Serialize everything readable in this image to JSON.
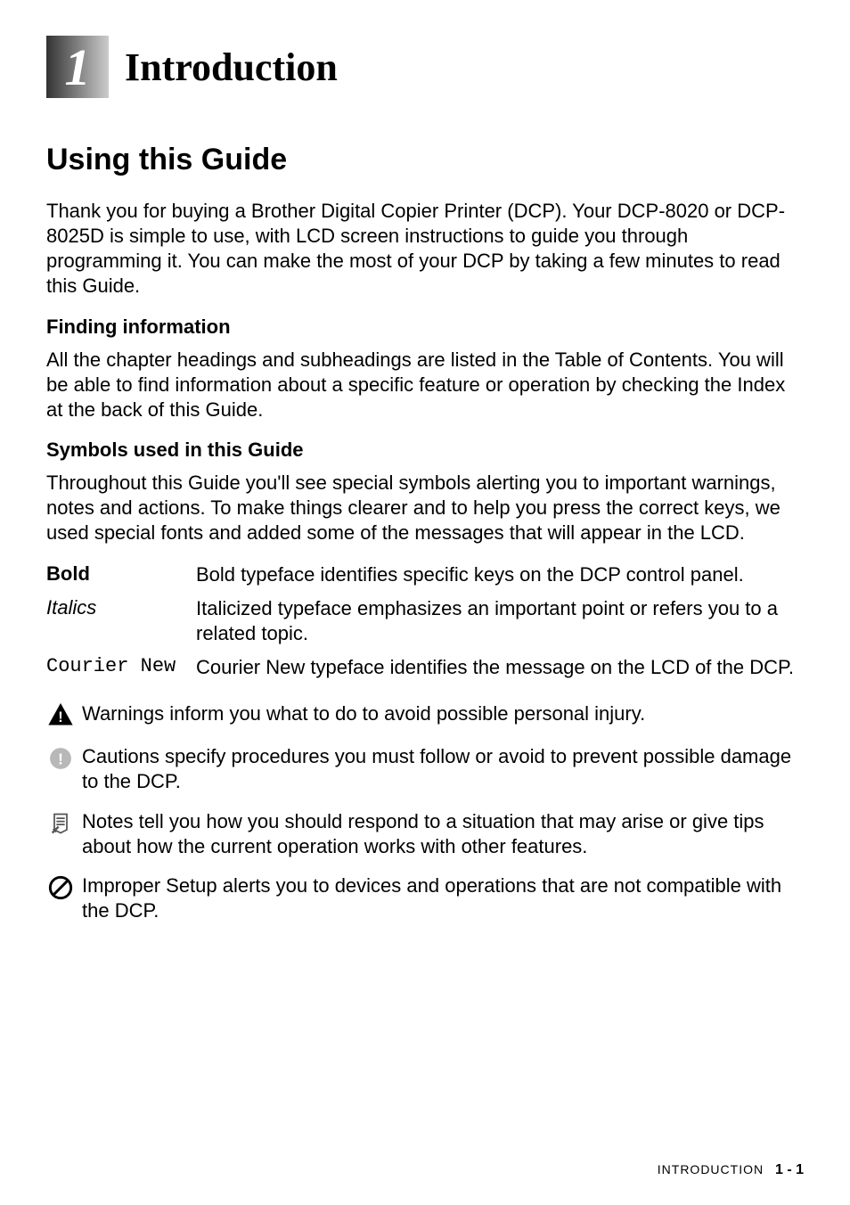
{
  "chapter": {
    "number": "1",
    "title": "Introduction"
  },
  "section": {
    "title": "Using this Guide",
    "intro": "Thank you for buying a Brother Digital Copier Printer (DCP). Your DCP-8020 or DCP-8025D is simple to use, with LCD screen instructions to guide you through programming it. You can make the most of your DCP by taking a few minutes to read this Guide."
  },
  "subsections": {
    "finding": {
      "title": "Finding information",
      "text": "All the chapter headings and subheadings are listed in the Table of Contents. You will be able to find information about a specific feature or operation by checking the Index at the back of this Guide."
    },
    "symbols": {
      "title": "Symbols used in this Guide",
      "text": "Throughout this Guide you'll see special symbols alerting you to important warnings, notes and actions. To make things clearer and to help you press the correct keys, we used special fonts and added some of the messages that will appear in the LCD."
    }
  },
  "typefaces": {
    "bold": {
      "label": "Bold",
      "desc": "Bold typeface identifies specific keys on the DCP control panel."
    },
    "italics": {
      "label": "Italics",
      "desc": "Italicized typeface emphasizes an important point or refers you to a related topic."
    },
    "courier": {
      "label": "Courier New",
      "desc": "Courier New typeface identifies the message on the LCD of the DCP."
    }
  },
  "symbolblocks": {
    "warning": "Warnings inform you what to do to avoid possible personal injury.",
    "caution": "Cautions specify procedures you must follow or avoid to prevent possible damage to the DCP.",
    "note": "Notes tell you how you should respond to a situation that may arise or give tips about how the current operation works with other features.",
    "improper": "Improper Setup alerts you to devices and operations that are not compatible with the DCP."
  },
  "footer": {
    "label": "INTRODUCTION",
    "page": "1 - 1"
  }
}
